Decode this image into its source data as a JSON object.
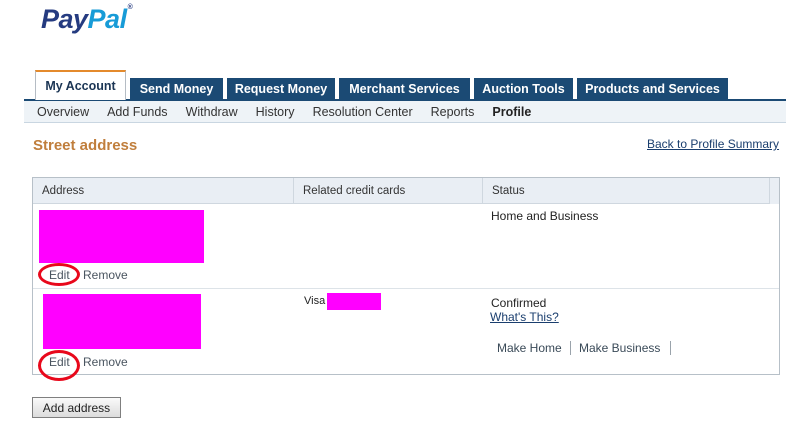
{
  "logo": {
    "pay": "Pay",
    "pal": "Pal",
    "tm": "®"
  },
  "tabs": [
    {
      "label": "My Account",
      "active": true
    },
    {
      "label": "Send Money"
    },
    {
      "label": "Request Money"
    },
    {
      "label": "Merchant Services"
    },
    {
      "label": "Auction Tools"
    },
    {
      "label": "Products and Services"
    }
  ],
  "subnav": [
    {
      "label": "Overview"
    },
    {
      "label": "Add Funds"
    },
    {
      "label": "Withdraw"
    },
    {
      "label": "History"
    },
    {
      "label": "Resolution Center"
    },
    {
      "label": "Reports"
    },
    {
      "label": "Profile",
      "active": true
    }
  ],
  "page": {
    "title": "Street address",
    "back_link": "Back to Profile Summary"
  },
  "table": {
    "headers": [
      "Address",
      "Related credit cards",
      "Status"
    ],
    "rows": [
      {
        "edit": "Edit",
        "remove": "Remove",
        "status": "Home and Business"
      },
      {
        "edit": "Edit",
        "remove": "Remove",
        "card": "Visa",
        "status": "Confirmed",
        "whats_this": "What's This?",
        "make_home": "Make Home",
        "make_business": "Make Business"
      }
    ]
  },
  "add_button": "Add address",
  "colors": {
    "tab_bg": "#1b4a74",
    "active_tab_accent": "#e48a2c",
    "title": "#c07e3c",
    "redaction": "#ff00ff",
    "annotation_circle": "#e8081b"
  }
}
